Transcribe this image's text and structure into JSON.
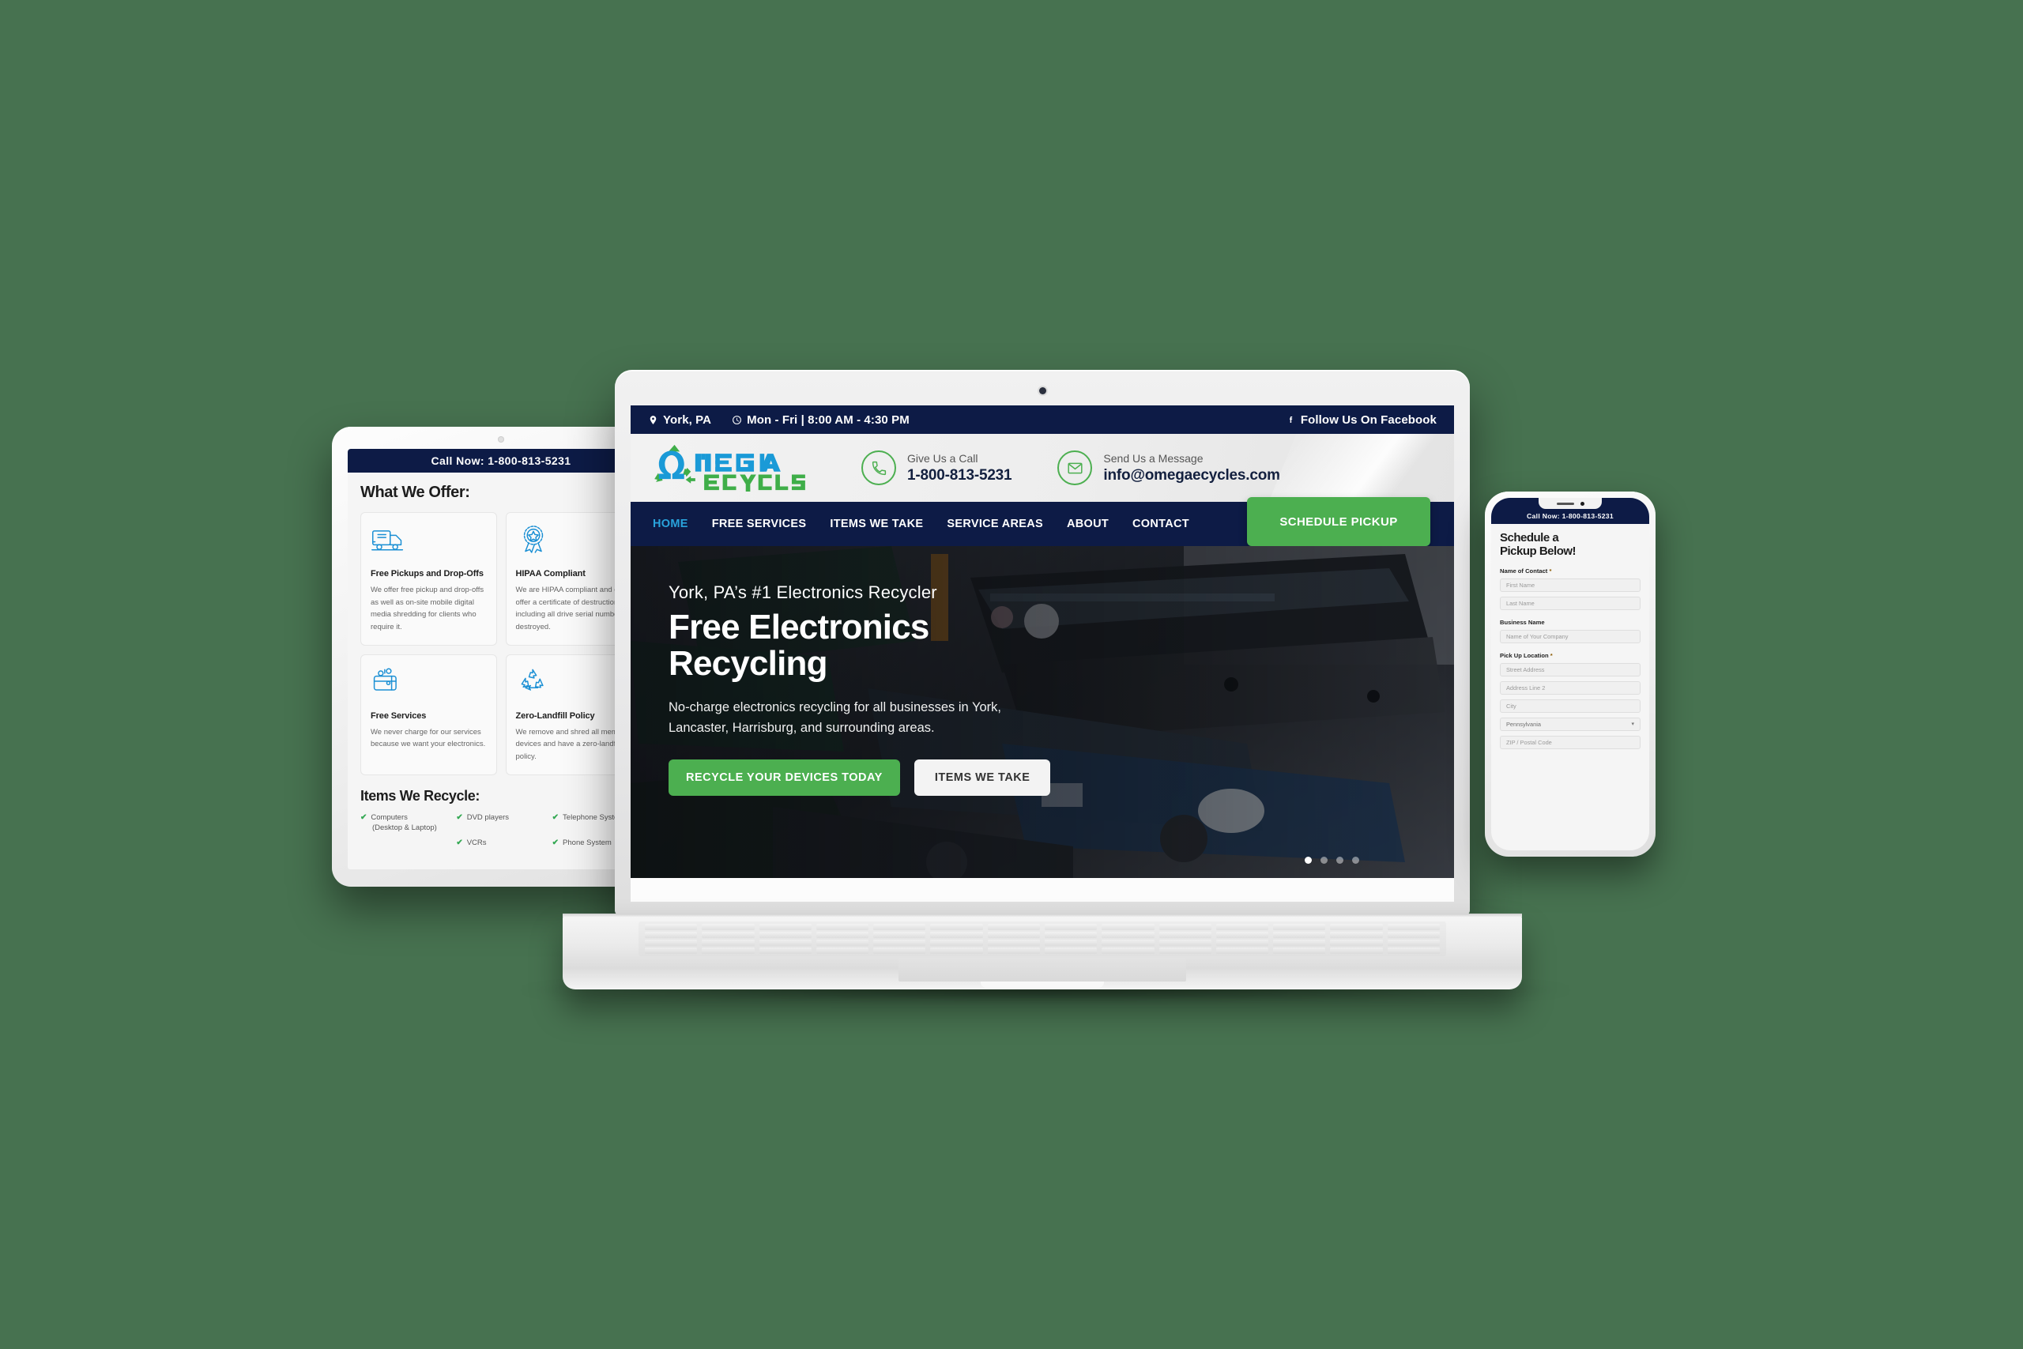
{
  "background_color": "#477250",
  "brand": {
    "name_primary": "OMEGA",
    "name_secondary": "ECycles",
    "navy": "#0d1b46",
    "green": "#4caf50",
    "blue": "#1a8fd4",
    "accent_light_blue": "#29a3dc"
  },
  "laptop": {
    "topbar": {
      "location": "York, PA",
      "hours": "Mon - Fri | 8:00 AM - 4:30 PM",
      "social": "Follow Us On Facebook"
    },
    "header": {
      "call": {
        "label": "Give Us a Call",
        "value": "1-800-813-5231"
      },
      "email": {
        "label": "Send Us a Message",
        "value": "info@omegaecycles.com"
      }
    },
    "nav": {
      "items": [
        {
          "label": "HOME",
          "active": true
        },
        {
          "label": "FREE SERVICES",
          "active": false
        },
        {
          "label": "ITEMS WE TAKE",
          "active": false
        },
        {
          "label": "SERVICE AREAS",
          "active": false
        },
        {
          "label": "ABOUT",
          "active": false
        },
        {
          "label": "CONTACT",
          "active": false
        }
      ],
      "cta": "SCHEDULE PICKUP"
    },
    "hero": {
      "kicker": "York, PA’s #1 Electronics Recycler",
      "title_line1": "Free Electronics",
      "title_line2": "Recycling",
      "subtitle": "No-charge electronics recycling for all businesses in York, Lancaster, Harrisburg, and surrounding areas.",
      "btn_primary": "RECYCLE YOUR DEVICES TODAY",
      "btn_secondary": "ITEMS WE TAKE",
      "carousel_dots": 4,
      "carousel_active": 1
    }
  },
  "tablet": {
    "callbar": "Call Now: 1-800-813-5231",
    "offer_heading": "What We Offer:",
    "cards": [
      {
        "icon": "delivery-truck-icon",
        "title": "Free Pickups and Drop-Offs",
        "text": "We offer free pickup and drop-offs as well as on-site mobile digital media shredding for clients who require it."
      },
      {
        "icon": "award-ribbon-icon",
        "title": "HIPAA Compliant",
        "text": "We are HIPAA compliant and can offer a certificate of destruction including all drive serial numbers destroyed."
      },
      {
        "icon": "wallet-icon",
        "title": "Free Services",
        "text": "We never charge for our services because we want your electronics."
      },
      {
        "icon": "recycle-arrows-icon",
        "title": "Zero-Landfill Policy",
        "text": "We remove and shred all memory devices and have a zero-landfill policy."
      }
    ],
    "recycle_heading": "Items We Recycle:",
    "recycle_items": [
      {
        "label": "Computers",
        "sub": "(Desktop & Laptop)"
      },
      {
        "label": "DVD players",
        "sub": ""
      },
      {
        "label": "Telephone Systems",
        "sub": ""
      },
      {
        "label": "",
        "sub": ""
      },
      {
        "label": "VCRs",
        "sub": ""
      },
      {
        "label": "Phone System",
        "sub": ""
      }
    ]
  },
  "phone": {
    "callbar": "Call Now: 1-800-813-5231",
    "title_line1": "Schedule a",
    "title_line2": "Pickup Below!",
    "fields": [
      {
        "kind": "label",
        "text": "Name of Contact",
        "required": true
      },
      {
        "kind": "input",
        "placeholder": "First Name"
      },
      {
        "kind": "input",
        "placeholder": "Last Name"
      },
      {
        "kind": "gap"
      },
      {
        "kind": "label",
        "text": "Business Name",
        "required": false
      },
      {
        "kind": "input",
        "placeholder": "Name of Your Company"
      },
      {
        "kind": "gap"
      },
      {
        "kind": "label",
        "text": "Pick Up Location",
        "required": true
      },
      {
        "kind": "input",
        "placeholder": "Street Address"
      },
      {
        "kind": "input",
        "placeholder": "Address Line 2"
      },
      {
        "kind": "input",
        "placeholder": "City"
      },
      {
        "kind": "select",
        "value": "Pennsylvania"
      },
      {
        "kind": "input",
        "placeholder": "ZIP / Postal Code"
      }
    ]
  }
}
